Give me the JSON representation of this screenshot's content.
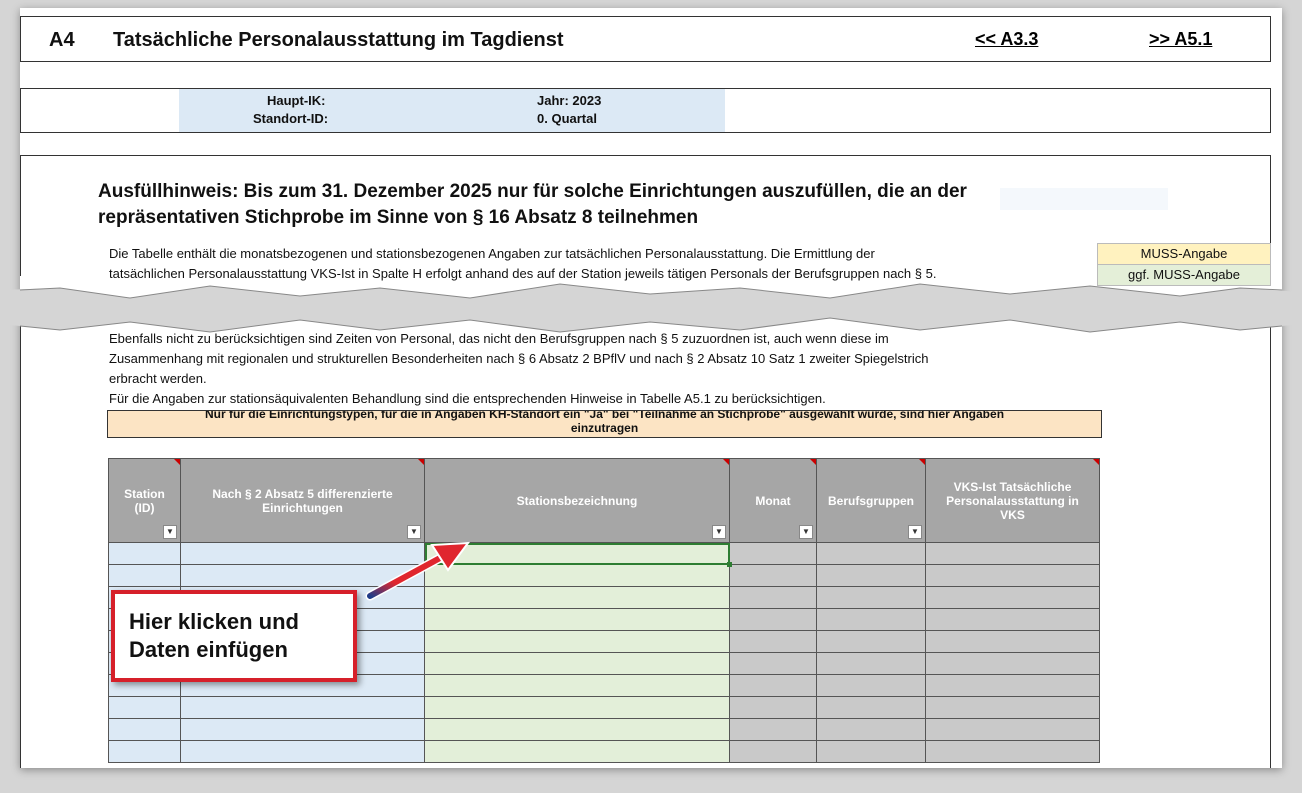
{
  "header": {
    "code": "A4",
    "title": "Tatsächliche Personalausstattung im Tagdienst",
    "link_prev": "<< A3.3",
    "link_next": ">> A5.1"
  },
  "info": {
    "haupt_ik": "Haupt-IK:",
    "standort_id": "Standort-ID:",
    "jahr": "Jahr: 2023",
    "quartal": "0. Quartal"
  },
  "hint": {
    "heading_line1": "Ausfüllhinweis: Bis zum 31. Dezember 2025 nur für solche Einrichtungen auszufüllen, die an der",
    "heading_line2": "repräsentativen Stichprobe im Sinne von § 16 Absatz 8 teilnehmen",
    "para_line1": "Die Tabelle enthält die monatsbezogenen und stationsbezogenen Angaben zur tatsächlichen Personalausstattung. Die Ermittlung der",
    "para_line2": "tatsächlichen Personalausstattung VKS-Ist in Spalte H erfolgt anhand des auf der Station jeweils tätigen Personals der Berufsgruppen nach § 5.",
    "para_line3": "Ebenfalls nicht zu berücksichtigen sind Zeiten von Personal, das nicht den Berufsgruppen nach § 5 zuzuordnen ist, auch wenn diese im",
    "para_line4": "Zusammenhang mit regionalen und strukturellen Besonderheiten nach § 6 Absatz 2 BPflV und nach § 2 Absatz 10 Satz 1 zweiter Spiegelstrich",
    "para_line5": "erbracht werden.",
    "para_line6": "Für die Angaben zur stationsäquivalenten Behandlung sind die entsprechenden Hinweise in Tabelle A5.1 zu berücksichtigen."
  },
  "legend": {
    "muss": "MUSS-Angabe",
    "ggf_muss": "ggf. MUSS-Angabe"
  },
  "note": {
    "line1": "Nur für die Einrichtungstypen, für die in Angaben KH-Standort ein \"Ja\" bei \"Teilnahme an Stichprobe\" ausgewählt wurde, sind hier Angaben",
    "line2": "einzutragen"
  },
  "table": {
    "columns": [
      {
        "l1": "Station",
        "l2": "(ID)",
        "l3": ""
      },
      {
        "l1": "Nach § 2 Absatz 5 differenzierte",
        "l2": "Einrichtungen",
        "l3": ""
      },
      {
        "l1": "Stationsbezeichnung",
        "l2": "",
        "l3": ""
      },
      {
        "l1": "Monat",
        "l2": "",
        "l3": ""
      },
      {
        "l1": "Berufsgruppen",
        "l2": "",
        "l3": ""
      },
      {
        "l1": "VKS-Ist Tatsächliche",
        "l2": "Personalausstattung in",
        "l3": "VKS"
      }
    ],
    "dropdown_icon": "▼"
  },
  "callout": {
    "line1": "Hier klicken und",
    "line2": "Daten einfügen"
  },
  "colors": {
    "input_blue": "#dce9f5",
    "input_green": "#e3efd9",
    "header_grey": "#a6a6a6",
    "calc_grey": "#c9c9c9",
    "callout_red": "#d6202a",
    "note_orange": "#fce4c4"
  }
}
